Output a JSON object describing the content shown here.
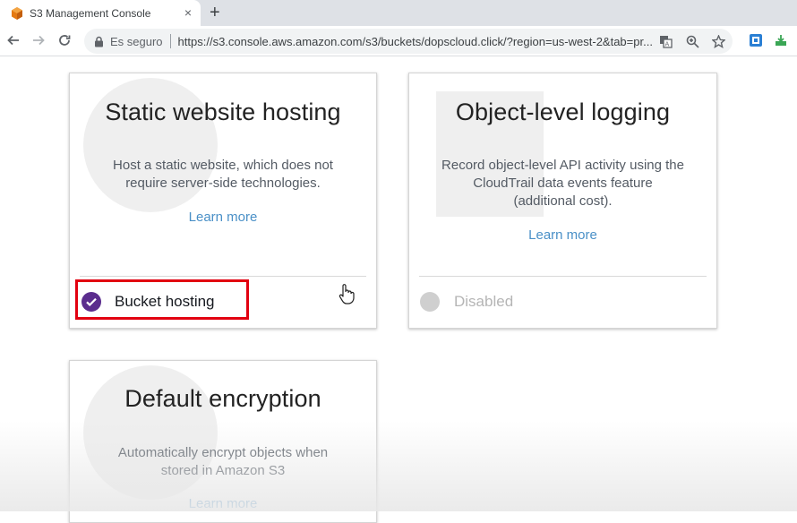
{
  "browser": {
    "tab_title": "S3 Management Console",
    "tab_close": "×",
    "new_tab": "+",
    "secure_label": "Es seguro",
    "url": "https://s3.console.aws.amazon.com/s3/buckets/dopscloud.click/?region=us-west-2&tab=pr..."
  },
  "cards": [
    {
      "title": "Static website hosting",
      "description": [
        "Host a static website, which does not",
        "require server-side technologies."
      ],
      "learn_more": "Learn more",
      "status": "Bucket hosting",
      "enabled": true
    },
    {
      "title": "Object-level logging",
      "description": [
        "Record object-level API activity using the",
        "CloudTrail data events feature",
        "(additional cost)."
      ],
      "learn_more": "Learn more",
      "status": "Disabled",
      "enabled": false
    },
    {
      "title": "Default encryption",
      "description": [
        "Automatically encrypt objects when",
        "stored in Amazon S3"
      ],
      "learn_more": "Learn more"
    }
  ],
  "colors": {
    "enabled_purple": "#5b2d8e",
    "disabled_gray": "#cfcfcf",
    "link_blue": "#4a90c7",
    "highlight_red": "#e20010"
  }
}
